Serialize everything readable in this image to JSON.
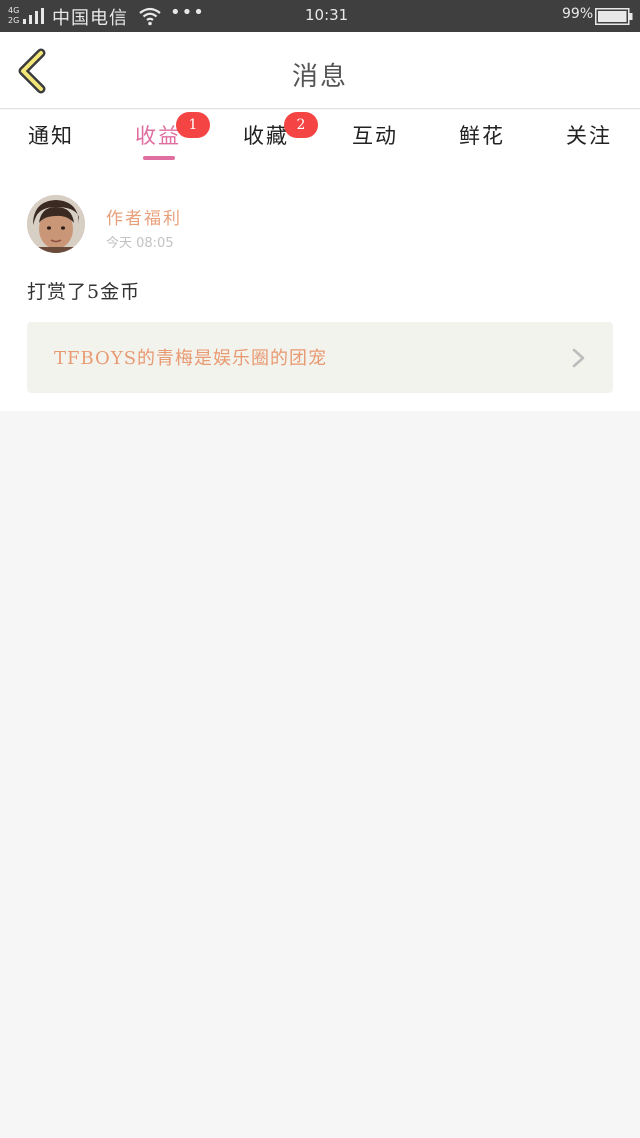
{
  "status_bar": {
    "network_top": "4G",
    "network_bottom": "2G",
    "carrier": "中国电信",
    "more": "•••",
    "time": "10:31",
    "battery": "99%"
  },
  "header": {
    "title": "消息"
  },
  "tabs": [
    {
      "label": "通知"
    },
    {
      "label": "收益",
      "badge": "1",
      "active": true
    },
    {
      "label": "收藏",
      "badge": "2"
    },
    {
      "label": "互动"
    },
    {
      "label": "鲜花"
    },
    {
      "label": "关注"
    }
  ],
  "message": {
    "sender": "作者福利",
    "time": "今天 08:05",
    "text": "打赏了5金币",
    "link_text": "TFBOYS的青梅是娱乐圈的团宠"
  },
  "colors": {
    "accent": "#e06ea0",
    "badge": "#f44444",
    "sender": "#e8a07a",
    "link": "#e89a72",
    "status_bar": "#3f3f3f"
  },
  "icons": {
    "back": "chevron-left-icon",
    "link_arrow": "chevron-right-icon",
    "wifi": "wifi-icon",
    "signal": "signal-icon",
    "battery": "battery-icon"
  }
}
